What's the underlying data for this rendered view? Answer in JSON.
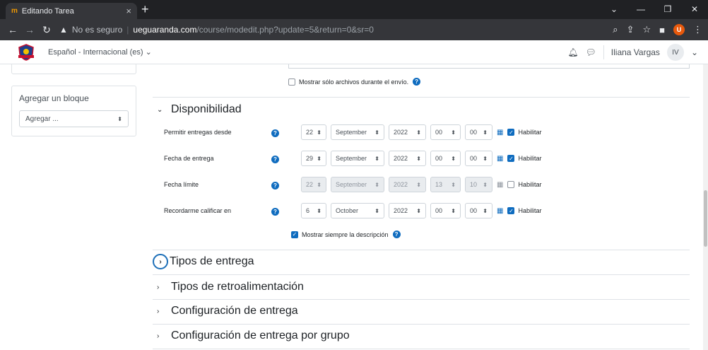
{
  "browser": {
    "tab_title": "Editando Tarea",
    "favicon": "m",
    "security_label": "No es seguro",
    "url_host": "ueguaranda.com",
    "url_path": "/course/modedit.php?update=5&return=0&sr=0",
    "profile_initial": "U"
  },
  "navbar": {
    "language": "Español - Internacional (es)",
    "user_name": "Iliana Vargas",
    "user_initials": "IV"
  },
  "sidebar": {
    "add_block_title": "Agregar un bloque",
    "add_block_select": "Agregar ..."
  },
  "form": {
    "only_files_label": "Mostrar sólo archivos durante el envío.",
    "availability_title": "Disponibilidad",
    "enable_label": "Habilitar",
    "rows": [
      {
        "label": "Permitir entregas desde",
        "day": "22",
        "month": "September",
        "year": "2022",
        "hour": "00",
        "minute": "00",
        "enabled": true
      },
      {
        "label": "Fecha de entrega",
        "day": "29",
        "month": "September",
        "year": "2022",
        "hour": "00",
        "minute": "00",
        "enabled": true
      },
      {
        "label": "Fecha límite",
        "day": "22",
        "month": "September",
        "year": "2022",
        "hour": "13",
        "minute": "10",
        "enabled": false
      },
      {
        "label": "Recordarme calificar en",
        "day": "6",
        "month": "October",
        "year": "2022",
        "hour": "00",
        "minute": "00",
        "enabled": true
      }
    ],
    "always_show_description": "Mostrar siempre la descripción",
    "sections": [
      "Tipos de entrega",
      "Tipos de retroalimentación",
      "Configuración de entrega",
      "Configuración de entrega por grupo"
    ]
  },
  "colors": {
    "primary": "#0f6cbf",
    "chrome_dark": "#202124",
    "chrome_bar": "#35363a"
  }
}
